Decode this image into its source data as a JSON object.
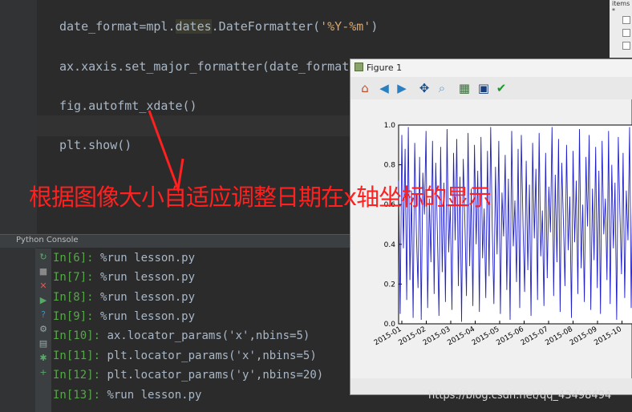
{
  "editor": {
    "lines": [
      {
        "prefix": "date_format=mpl.",
        "word": "dates",
        "mid": ".DateFormatter(",
        "str": "'%Y-%m'",
        "suffix": ")"
      },
      {
        "text": "ax.xaxis.set_major_formatter(date_format)"
      },
      {
        "text": "fig.autofmt_xdate()"
      },
      {
        "text": "plt.show()"
      }
    ]
  },
  "console": {
    "title": "Python Console",
    "lines": [
      {
        "prompt": "In[6]:",
        "cmd": "%run lesson.py"
      },
      {
        "prompt": "In[7]:",
        "cmd": "%run lesson.py"
      },
      {
        "prompt": "In[8]:",
        "cmd": "%run lesson.py"
      },
      {
        "prompt": "In[9]:",
        "cmd": "%run lesson.py"
      },
      {
        "prompt": "In[10]:",
        "cmd": "ax.locator_params('x',nbins=5)"
      },
      {
        "prompt": "In[11]:",
        "cmd": "plt.locator_params('x',nbins=5)"
      },
      {
        "prompt": "In[12]:",
        "cmd": "plt.locator_params('y',nbins=20)"
      },
      {
        "prompt": "In[13]:",
        "cmd": "%run lesson.py"
      }
    ]
  },
  "overlay": {
    "text": "根据图像大小自适应调整日期在x轴坐标的显示"
  },
  "right_strip": {
    "text": "items *"
  },
  "figure": {
    "title": "Figure 1",
    "toolbar": [
      "home-icon",
      "back-icon",
      "forward-icon",
      "pan-icon",
      "zoom-icon",
      "subplots-icon",
      "save-icon",
      "check-icon"
    ]
  },
  "chart_data": {
    "type": "line",
    "x_ticks": [
      "2015-01",
      "2015-02",
      "2015-03",
      "2015-04",
      "2015-05",
      "2015-06",
      "2015-07",
      "2015-08",
      "2015-09",
      "2015-10"
    ],
    "y_ticks": [
      "0.0",
      "0.2",
      "0.4",
      "0.6",
      "0.8",
      "1.0"
    ],
    "ylim": [
      0,
      1
    ],
    "color": "#2020c8",
    "values": [
      0.72,
      0.05,
      0.95,
      0.38,
      0.88,
      0.12,
      0.99,
      0.22,
      0.67,
      0.03,
      0.91,
      0.45,
      0.18,
      0.84,
      0.02,
      0.76,
      0.55,
      0.97,
      0.08,
      0.63,
      0.31,
      0.92,
      0.15,
      0.81,
      0.47,
      0.04,
      0.89,
      0.26,
      0.71,
      0.11,
      0.98,
      0.36,
      0.6,
      0.07,
      0.86,
      0.42,
      0.93,
      0.19,
      0.74,
      0.01,
      0.83,
      0.52,
      0.14,
      0.96,
      0.29,
      0.68,
      0.09,
      0.9,
      0.4,
      0.77,
      0.06,
      0.94,
      0.33,
      0.58,
      0.13,
      0.87,
      0.24,
      0.99,
      0.48,
      0.1,
      0.79,
      0.35,
      0.92,
      0.05,
      0.66,
      0.44,
      0.85,
      0.17,
      0.73,
      0.02,
      0.97,
      0.39,
      0.62,
      0.21,
      0.88,
      0.08,
      0.95,
      0.5,
      0.16,
      0.82,
      0.27,
      0.7,
      0.04,
      0.91,
      0.43,
      0.78,
      0.12,
      0.96,
      0.34,
      0.57,
      0.09,
      0.86,
      0.23,
      0.69,
      0.46,
      0.99,
      0.14,
      0.75,
      0.31,
      0.93,
      0.06,
      0.81,
      0.53,
      0.19,
      0.9,
      0.37,
      0.64,
      0.03,
      0.87,
      0.41,
      0.72,
      0.15,
      0.98,
      0.28,
      0.6,
      0.11,
      0.84,
      0.49,
      0.95,
      0.07,
      0.68,
      0.32,
      0.89,
      0.18,
      0.77,
      0.05,
      0.92,
      0.45,
      0.63,
      0.22,
      0.97,
      0.1,
      0.8,
      0.38,
      0.71,
      0.02,
      0.94,
      0.56,
      0.25,
      0.86,
      0.13,
      0.67,
      0.42,
      0.99,
      0.08,
      0.79
    ]
  },
  "watermark": {
    "text": "https://blog.csdn.net/qq_43498494"
  }
}
